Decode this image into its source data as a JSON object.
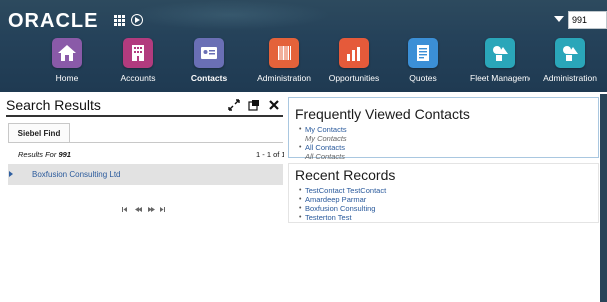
{
  "header": {
    "logo": "ORACLE",
    "search_value": "991",
    "nav": [
      {
        "label": "Home",
        "icon": "home-icon",
        "color": "#8a5aa8"
      },
      {
        "label": "Accounts",
        "icon": "building-icon",
        "color": "#b23b7e"
      },
      {
        "label": "Contacts",
        "icon": "contact-card-icon",
        "color": "#6a6fb5",
        "active": true
      },
      {
        "label": "Administration",
        "icon": "barcode-icon",
        "color": "#e4623a"
      },
      {
        "label": "Opportunities",
        "icon": "bar-chart-icon",
        "color": "#e55a3a"
      },
      {
        "label": "Quotes",
        "icon": "document-icon",
        "color": "#3b8fd6"
      },
      {
        "label": "Fleet Manageme",
        "icon": "shapes-icon",
        "color": "#2aa6b9"
      },
      {
        "label": "Administration",
        "icon": "shapes-icon",
        "color": "#2aa6b9"
      }
    ]
  },
  "left": {
    "title": "Search Results",
    "tab": "Siebel Find",
    "results_label": "Results For",
    "results_query": "991",
    "results_count": "1 - 1 of 1",
    "rows": [
      {
        "name": "Boxfusion Consulting Ltd"
      }
    ]
  },
  "right": {
    "frequent_title": "Frequently Viewed Contacts",
    "frequent": [
      {
        "label": "My Contacts",
        "sub": "My Contacts"
      },
      {
        "label": "All Contacts",
        "sub": "All Contacts"
      }
    ],
    "recent_title": "Recent Records",
    "recent": [
      "TestContact TestContact",
      "Amardeep Parmar",
      "Boxfusion Consulting",
      "Testerton Test"
    ]
  }
}
